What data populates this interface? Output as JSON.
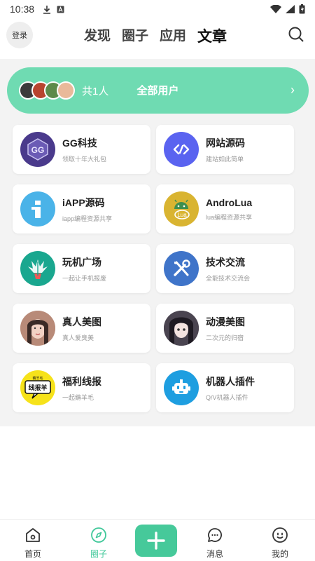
{
  "status_bar": {
    "time": "10:38"
  },
  "header": {
    "login_label": "登录",
    "tabs": [
      {
        "label": "发现"
      },
      {
        "label": "圈子"
      },
      {
        "label": "应用"
      },
      {
        "label": "文章",
        "active": true
      }
    ]
  },
  "banner": {
    "count_text": "共1人",
    "title": "全部用户",
    "arrow": "›"
  },
  "cards": [
    {
      "title": "GG科技",
      "desc": "领取十年大礼包",
      "icon": "gg-logo-icon",
      "color": "#4a3a8c"
    },
    {
      "title": "网站源码",
      "desc": "建站如此简单",
      "icon": "code-link-icon",
      "color": "#5a63f0"
    },
    {
      "title": "iAPP源码",
      "desc": "iapp编程资源共享",
      "icon": "iapp-icon",
      "color": "#4ab3e8"
    },
    {
      "title": "AndroLua",
      "desc": "lua编程资源共享",
      "icon": "androlua-icon",
      "color": "#d9b431"
    },
    {
      "title": "玩机广场",
      "desc": "一起让手机报废",
      "icon": "magisk-icon",
      "color": "#1aa78f"
    },
    {
      "title": "技术交流",
      "desc": "全能技术交流会",
      "icon": "tools-icon",
      "color": "#3f74c9"
    },
    {
      "title": "真人美图",
      "desc": "真人爱臭美",
      "icon": "photo-avatar-icon",
      "color": "#c99a85"
    },
    {
      "title": "动漫美图",
      "desc": "二次元的归宿",
      "icon": "anime-avatar-icon",
      "color": "#5e5460"
    },
    {
      "title": "福利线报",
      "desc": "一起薅羊毛",
      "icon": "news-sign-icon",
      "color": "#f6e21a"
    },
    {
      "title": "机器人插件",
      "desc": "Q/V机器人插件",
      "icon": "robot-icon",
      "color": "#1e9ee0"
    }
  ],
  "card_news_sign": {
    "top": "薅羊毛",
    "bottom": "线报羊"
  },
  "nav": {
    "items": [
      {
        "label": "首页",
        "icon": "home-icon"
      },
      {
        "label": "圈子",
        "icon": "compass-icon",
        "active": true
      },
      {
        "label": "消息",
        "icon": "message-icon"
      },
      {
        "label": "我的",
        "icon": "profile-icon"
      }
    ]
  },
  "colors": {
    "accent": "#46c99a",
    "banner": "#6fdbb2",
    "background": "#f3f3f3"
  }
}
